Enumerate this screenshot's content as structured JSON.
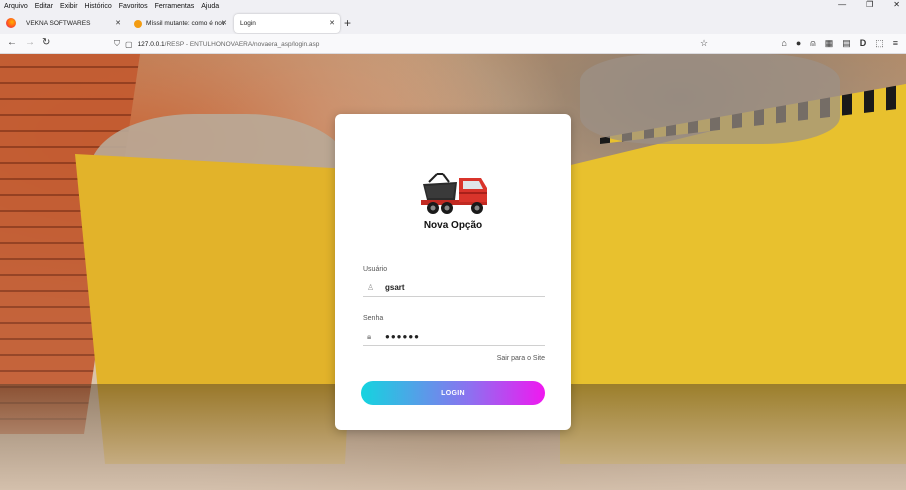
{
  "menubar": {
    "items": [
      "Arquivo",
      "Editar",
      "Exibir",
      "Histórico",
      "Favoritos",
      "Ferramentas",
      "Ajuda"
    ]
  },
  "window_controls": {
    "minimize": "—",
    "maximize": "❐",
    "close": "✕"
  },
  "tabs": [
    {
      "label": "VEKNA SOFTWARES",
      "close": "✕"
    },
    {
      "label": "Míssil mutante: como é nova arma",
      "close": "✕"
    },
    {
      "label": "Login",
      "close": "✕"
    }
  ],
  "newtab": "+",
  "nav": {
    "back": "←",
    "forward": "→",
    "reload": "↻",
    "url_host": "127.0.0.1",
    "url_path": "/RESP - ENTULHONOVAERA/novaera_asp/login.asp",
    "bookmark": "☆"
  },
  "toolbar_icons": [
    "⌂",
    "●",
    "⍝",
    "▦",
    "▤",
    "D",
    "⬚",
    "≡"
  ],
  "login": {
    "brand": "Nova Opção",
    "user_label": "Usuário",
    "user_value": "gsart",
    "password_label": "Senha",
    "password_value": "●●●●●●",
    "exit_link": "Sair para o Site",
    "login_button": "LOGIN"
  },
  "colors": {
    "accent_start": "#14d4df",
    "accent_end": "#f018f0",
    "truck_red": "#d9342b"
  }
}
